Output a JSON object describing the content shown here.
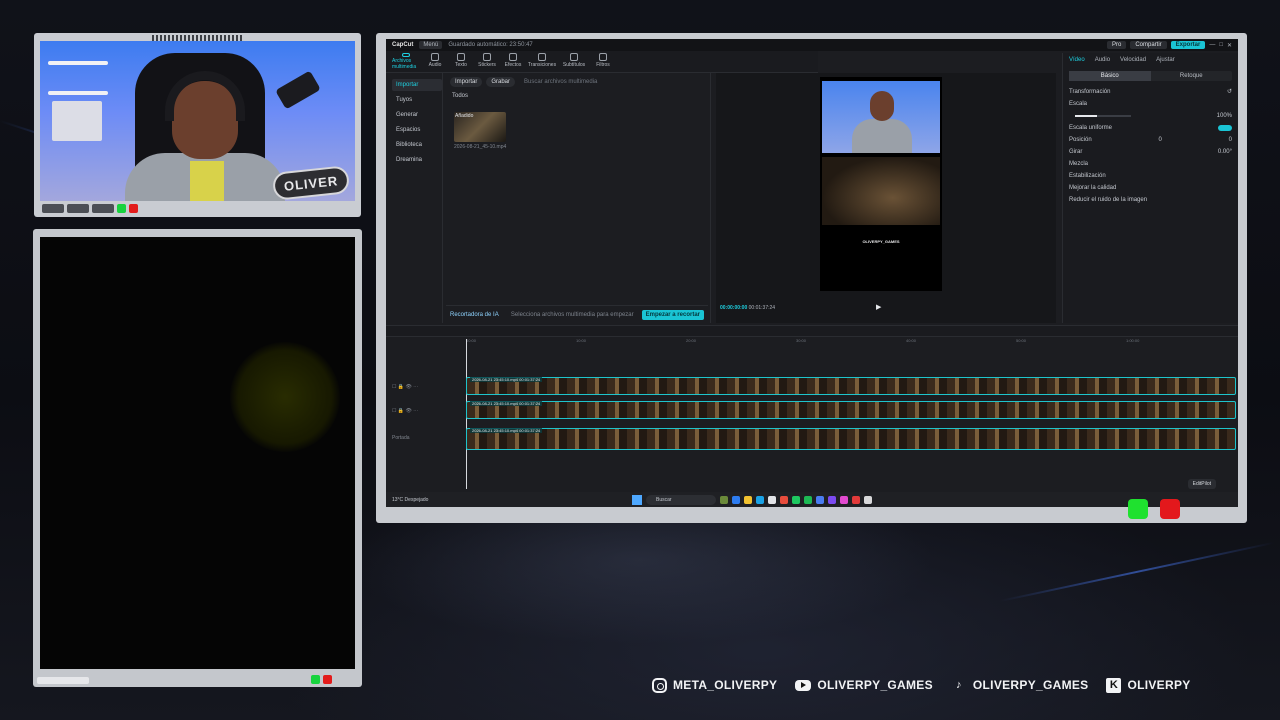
{
  "webcam": {
    "badge": "OLIVER"
  },
  "app": {
    "title": "CapCut",
    "menu": "Menú",
    "saved": "Guardado automático: 23:50:47",
    "pro": "Pro",
    "share": "Compartir",
    "export": "Exportar",
    "tools": [
      {
        "label": "Archivos multimedia",
        "active": true
      },
      {
        "label": "Audio"
      },
      {
        "label": "Texto"
      },
      {
        "label": "Stickers"
      },
      {
        "label": "Efectos"
      },
      {
        "label": "Transiciones"
      },
      {
        "label": "Subtítulos"
      },
      {
        "label": "Filtros"
      }
    ],
    "leftnav": [
      "Importar",
      "Tuyos",
      "Generar",
      "Espacios",
      "Biblioteca",
      "Dreamina"
    ],
    "media": {
      "import_btn": "Importar",
      "record_btn": "Grabar",
      "search_placeholder": "Buscar archivos multimedia",
      "section": "Todos",
      "thumb_badge": "Añadido",
      "thumb_name": "2026-08-21_45-10.mp4",
      "ai_label": "Recortadora de IA",
      "hint": "Selecciona archivos multimedia para empezar",
      "start_btn": "Empezar a recortar"
    },
    "player": {
      "time_current": "00:00:00:00",
      "time_total": "00:01:37:24",
      "preview_text": "OLIVERPY_GAMES"
    },
    "props": {
      "tabs": [
        "Vídeo",
        "Audio",
        "Velocidad",
        "Ajustar"
      ],
      "subtabs": [
        "Básico",
        "Retoque"
      ],
      "transform": "Transformación",
      "scale": "Escala",
      "scale_val": "100%",
      "uniform": "Escala uniforme",
      "position": "Posición",
      "pos_x": "0",
      "pos_y": "0",
      "rotate": "Girar",
      "rotate_val": "0.00°",
      "blend": "Mezcla",
      "stabilize": "Estabilización",
      "enhance": "Mejorar la calidad",
      "denoise": "Reducir el ruido de la imagen"
    },
    "timeline": {
      "ruler": [
        "00:00",
        "10:00",
        "20:00",
        "30:00",
        "40:00",
        "50:00",
        "1:00:00"
      ],
      "track1": "2026-08-21 23:45:10.mp4  00:01:37:24",
      "track2": "2026-08-21 23:45:10.mp4  00:01:37:24",
      "track3": "2026-08-21 23:45:10.mp4  00:01:37:24",
      "cover": "Portada",
      "editpilot": "EditPilot"
    },
    "taskbar": {
      "weather": "13°C Despejado",
      "search": "Buscar"
    }
  },
  "socials": [
    {
      "icon": "instagram-icon",
      "handle": "META_OLIVERPY"
    },
    {
      "icon": "youtube-icon",
      "handle": "OLIVERPY_GAMES"
    },
    {
      "icon": "tiktok-icon",
      "handle": "OLIVERPY_GAMES"
    },
    {
      "icon": "kick-icon",
      "handle": "OLIVERPY"
    }
  ],
  "colors": {
    "accent": "#1ac4d4",
    "green": "#1fe12f",
    "red": "#e3181c"
  }
}
